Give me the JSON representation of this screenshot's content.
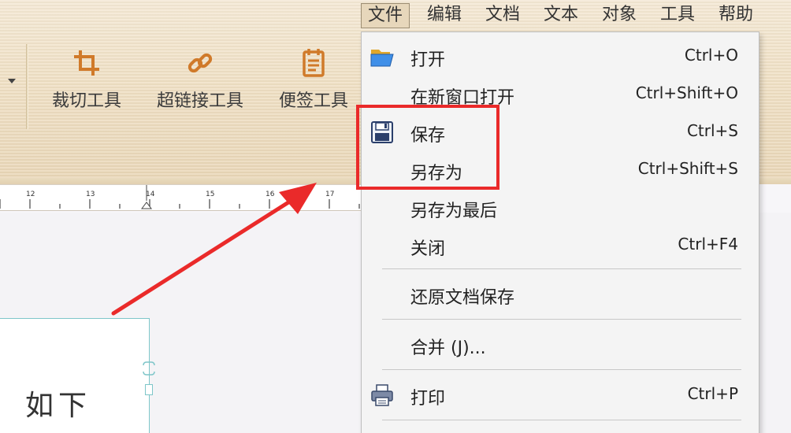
{
  "menubar": {
    "items": [
      {
        "label": "文件",
        "active": true
      },
      {
        "label": "编辑"
      },
      {
        "label": "文档"
      },
      {
        "label": "文本"
      },
      {
        "label": "对象"
      },
      {
        "label": "工具"
      },
      {
        "label": "帮助"
      }
    ]
  },
  "toolbar": {
    "tools": [
      {
        "label": "裁切工具",
        "icon": "crop-icon"
      },
      {
        "label": "超链接工具",
        "icon": "link-icon"
      },
      {
        "label": "便签工具",
        "icon": "note-icon"
      }
    ]
  },
  "ruler": {
    "marks": [
      "12",
      "13",
      "14",
      "15",
      "16",
      "17"
    ]
  },
  "document": {
    "textbox_text": "如下"
  },
  "file_menu": {
    "items": [
      {
        "label": "打开",
        "shortcut": "Ctrl+O",
        "icon": "folder-open-icon"
      },
      {
        "label": "在新窗口打开",
        "shortcut": "Ctrl+Shift+O"
      },
      {
        "label": "保存",
        "shortcut": "Ctrl+S",
        "icon": "floppy-disk-icon",
        "highlighted": true
      },
      {
        "label": "另存为",
        "shortcut": "Ctrl+Shift+S",
        "highlighted": true
      },
      {
        "label": "另存为最后",
        "shortcut": ""
      },
      {
        "label": "关闭",
        "shortcut": "Ctrl+F4"
      },
      {
        "label": "还原文档保存",
        "shortcut": ""
      },
      {
        "label": "合并 (J)...",
        "shortcut": ""
      },
      {
        "label": "打印",
        "shortcut": "Ctrl+P",
        "icon": "printer-icon"
      }
    ]
  },
  "colors": {
    "annotation_red": "#ea2a2a",
    "toolbar_tan": "#efdfc3",
    "textbox_border": "#7ec6c9"
  }
}
